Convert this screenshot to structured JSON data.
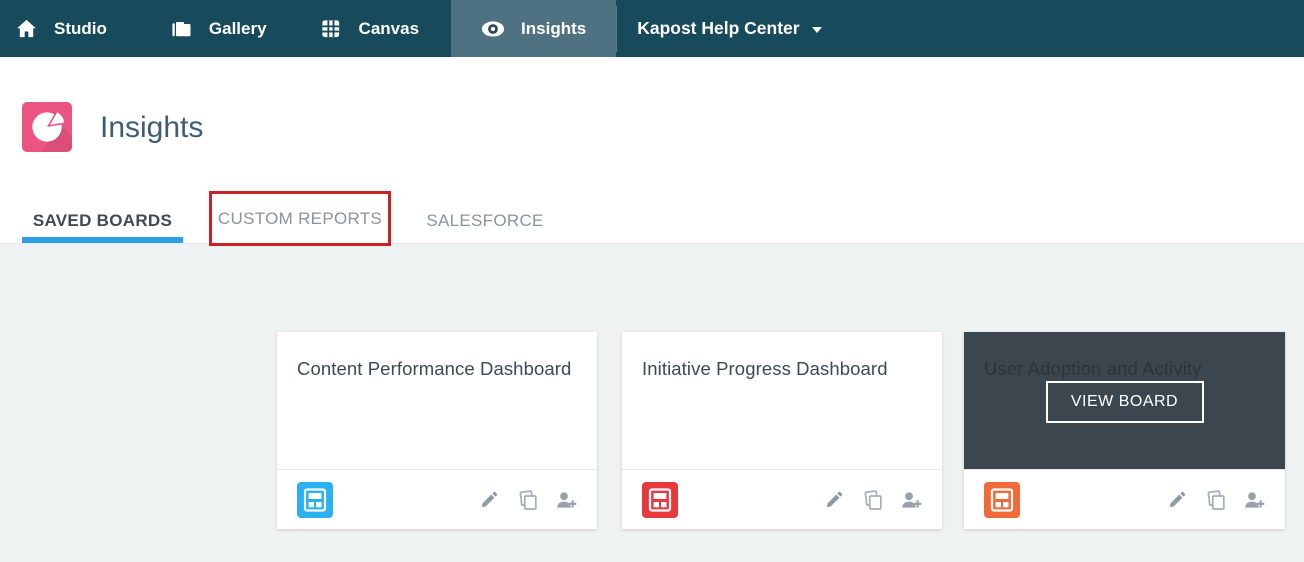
{
  "nav": {
    "items": [
      {
        "label": "Studio",
        "icon": "home-icon"
      },
      {
        "label": "Gallery",
        "icon": "folder-icon"
      },
      {
        "label": "Canvas",
        "icon": "grid-icon"
      },
      {
        "label": "Insights",
        "icon": "eye-icon",
        "active": true
      }
    ],
    "help": {
      "label": "Kapost Help Center",
      "icon": "caret-down-icon"
    }
  },
  "header": {
    "title": "Insights",
    "app_icon": "pie-chart-icon"
  },
  "tabs": [
    {
      "label": "SAVED BOARDS",
      "active": true,
      "annotated": false
    },
    {
      "label": "CUSTOM REPORTS",
      "active": false,
      "annotated": true
    },
    {
      "label": "SALESFORCE",
      "active": false,
      "annotated": false
    }
  ],
  "boards": [
    {
      "title": "Content Performance Dashboard",
      "icon": "board-layout-icon",
      "icon_color": "#29b2ef",
      "hovered": false
    },
    {
      "title": "Initiative Progress Dashboard",
      "icon": "board-layout-icon",
      "icon_color": "#e8393e",
      "hovered": false
    },
    {
      "title": "User Adoption and Activity",
      "icon": "board-layout-icon",
      "icon_color": "#f26a38",
      "hovered": true,
      "view_button_label": "VIEW BOARD"
    }
  ],
  "board_actions": [
    "edit",
    "duplicate",
    "add-user"
  ],
  "colors": {
    "nav_bg": "#174a5a",
    "nav_active_bg": "#4e7282",
    "accent_blue": "#2e9fe1",
    "annotation_red": "#cb2026",
    "app_icon_pink": "#eb5480",
    "content_bg": "#eff2f2",
    "hover_overlay": "#3c464e"
  }
}
